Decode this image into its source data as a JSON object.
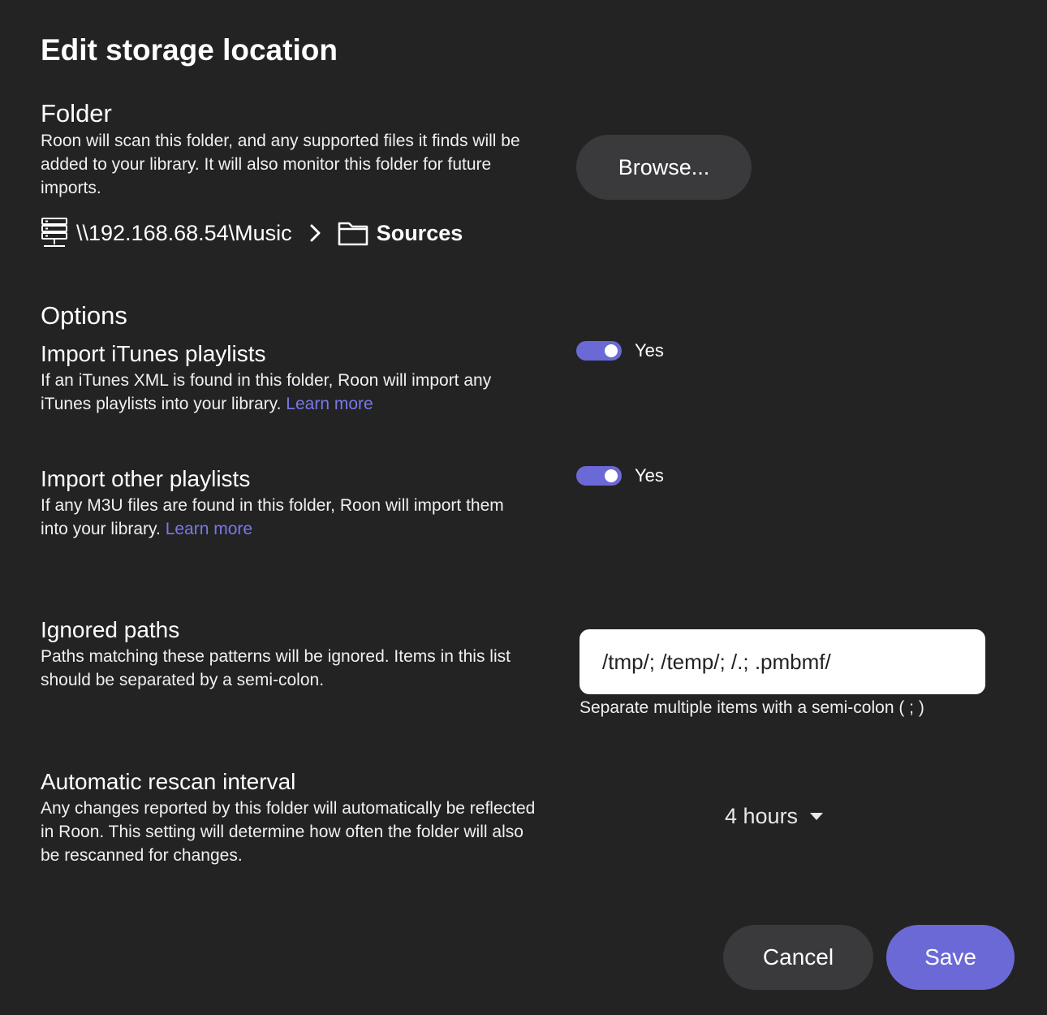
{
  "dialog": {
    "title": "Edit storage location"
  },
  "folder": {
    "heading": "Folder",
    "description": "Roon will scan this folder, and any supported files it finds will be added to your library. It will also monitor this folder for future imports.",
    "browse_label": "Browse...",
    "path": {
      "root": "\\\\192.168.68.54\\Music",
      "current": "Sources",
      "root_icon": "server-icon",
      "separator_icon": "chevron-right-icon",
      "current_icon": "folder-icon"
    }
  },
  "options": {
    "heading": "Options",
    "itunes": {
      "title": "Import iTunes playlists",
      "description": "If an iTunes XML is found in this folder, Roon will import any iTunes playlists into your library.",
      "link": "Learn more",
      "enabled": true,
      "state_label": "Yes"
    },
    "other": {
      "title": "Import other playlists",
      "description": "If any M3U files are found in this folder, Roon will import them into your library.",
      "link": "Learn more",
      "enabled": true,
      "state_label": "Yes"
    },
    "ignored": {
      "title": "Ignored paths",
      "description": "Paths matching these patterns will be ignored. Items in this list should be separated by a semi-colon.",
      "value": "/tmp/; /temp/; /.; .pmbmf/",
      "hint": "Separate multiple items with a semi-colon ( ; )"
    },
    "rescan": {
      "title": "Automatic rescan interval",
      "description": "Any changes reported by this folder will automatically be reflected in Roon. This setting will determine how often the folder will also be rescanned for changes.",
      "selected": "4 hours"
    }
  },
  "footer": {
    "cancel_label": "Cancel",
    "save_label": "Save"
  },
  "colors": {
    "background": "#232324",
    "accent": "#6b69d6",
    "link": "#7a78e6",
    "button": "#3a3a3c"
  }
}
